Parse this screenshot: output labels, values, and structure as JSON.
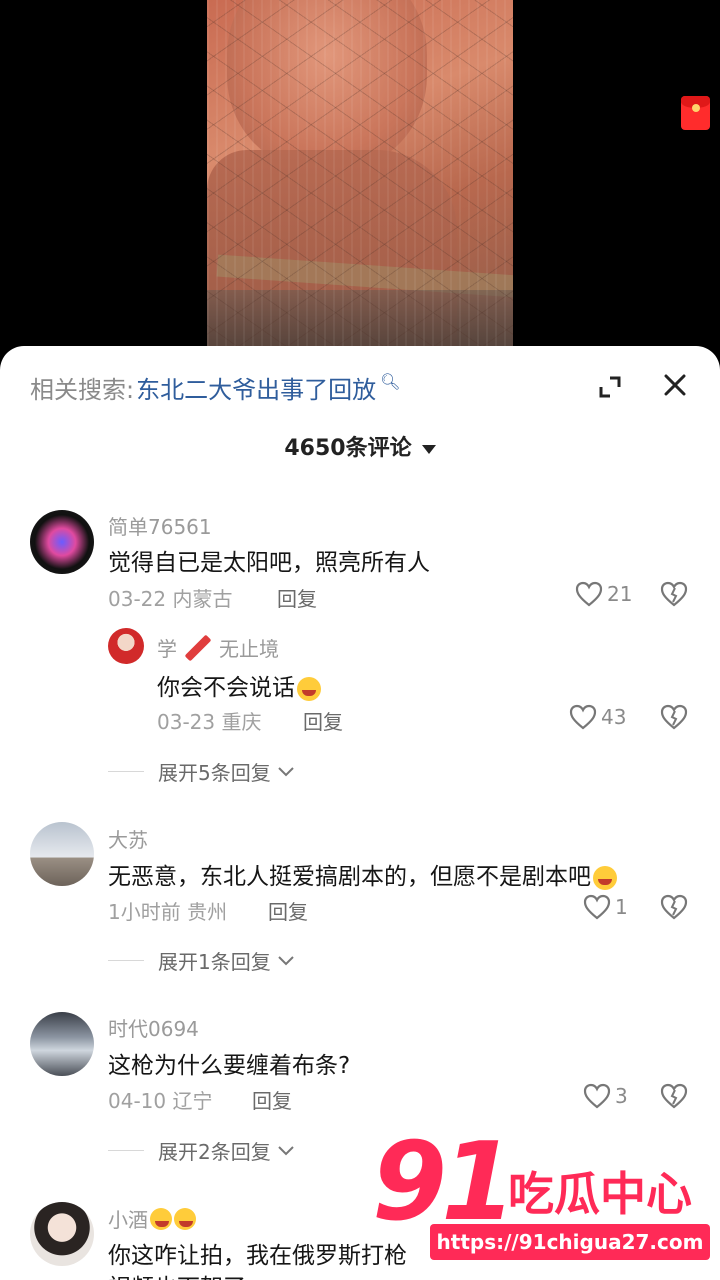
{
  "related_search": {
    "prefix": "相关搜索:",
    "keyword": "东北二大爷出事了回放"
  },
  "comment_count": "4650条评论",
  "comments": [
    {
      "user": "简单76561",
      "text": "觉得自已是太阳吧，照亮所有人",
      "date": "03-22 内蒙古",
      "reply": "回复",
      "likes": "21",
      "sub": {
        "user_a": "学",
        "user_b": "无止境",
        "text": "你会不会说话",
        "date": "03-23 重庆",
        "reply": "回复",
        "likes": "43"
      },
      "expand": "展开5条回复"
    },
    {
      "user": "大苏",
      "text": "无恶意，东北人挺爱搞剧本的，但愿不是剧本吧",
      "date": "1小时前 贵州",
      "reply": "回复",
      "likes": "1",
      "expand": "展开1条回复"
    },
    {
      "user": "时代0694",
      "text": "这枪为什么要缠着布条?",
      "date": "04-10 辽宁",
      "reply": "回复",
      "likes": "3",
      "expand": "展开2条回复"
    },
    {
      "user": "小酒",
      "text": "你这咋让拍，我在俄罗斯打枪",
      "text2": "视频也下架了"
    }
  ],
  "watermark": {
    "number": "91",
    "name": "吃瓜中心",
    "url": "https://91chigua27.com"
  },
  "colors": {
    "keyword": "#2f5d9c",
    "watermark": "#ff2a57",
    "red_packet": "#ff2c2c"
  },
  "icons": [
    "red-packet-icon",
    "search-icon",
    "expand-icon",
    "close-icon",
    "caret-down-icon",
    "heart-icon",
    "broken-heart-icon",
    "chevron-down-icon"
  ]
}
